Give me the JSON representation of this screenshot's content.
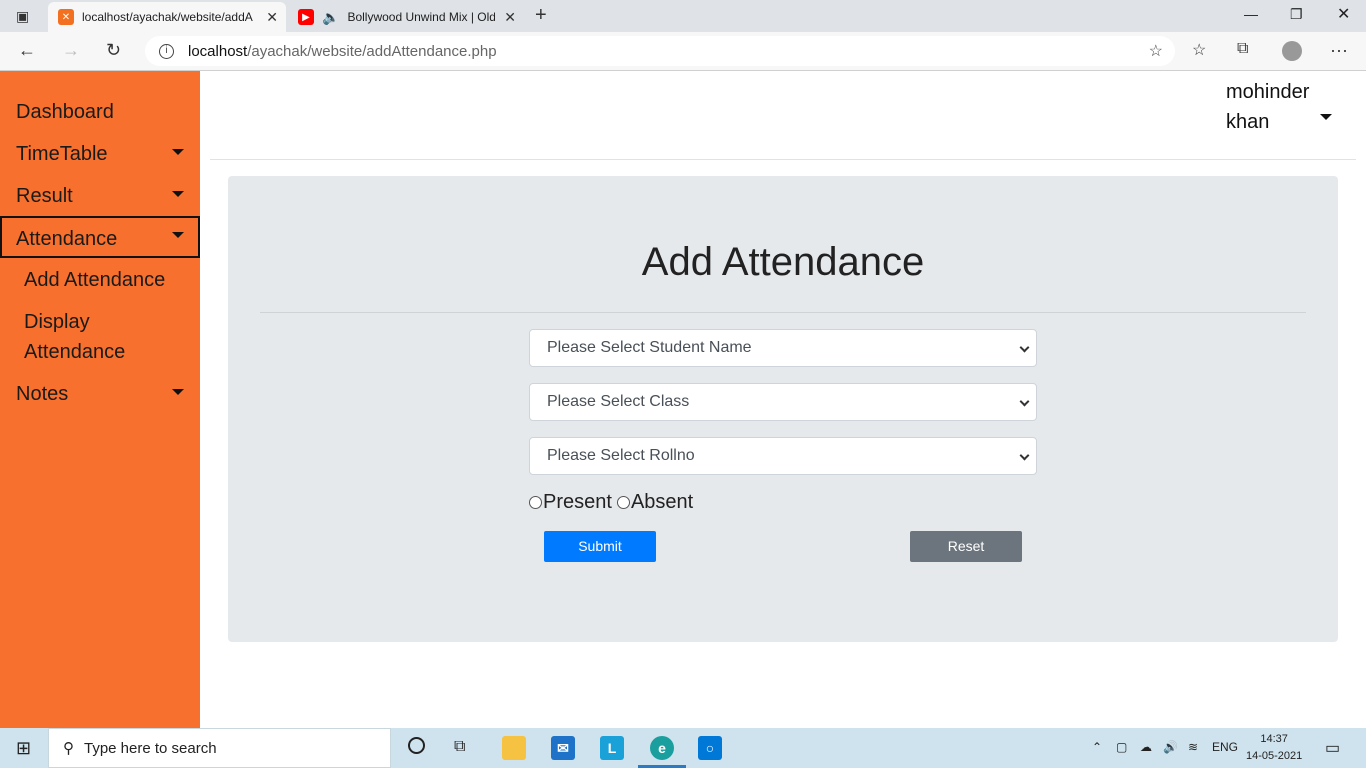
{
  "browser": {
    "tabs": [
      {
        "title": "localhost/ayachak/website/addA",
        "active": true
      },
      {
        "title": "Bollywood Unwind Mix | Old",
        "active": false
      }
    ],
    "url_host": "localhost",
    "url_path": "/ayachak/website/addAttendance.php"
  },
  "sidebar": {
    "items": [
      {
        "label": "Dashboard",
        "has_dropdown": false
      },
      {
        "label": "TimeTable",
        "has_dropdown": true
      },
      {
        "label": "Result",
        "has_dropdown": true
      },
      {
        "label": "Attendance",
        "has_dropdown": true,
        "active": true
      },
      {
        "label": "Notes",
        "has_dropdown": true
      }
    ],
    "sub_items": [
      {
        "label": "Add Attendance"
      },
      {
        "label": "Display Attendance"
      }
    ]
  },
  "user": {
    "first": "mohinder",
    "last": "khan"
  },
  "form": {
    "title": "Add Attendance",
    "student_select": "Please Select Student Name",
    "class_select": "Please Select Class",
    "rollno_select": "Please Select Rollno",
    "present_label": "Present",
    "absent_label": "Absent",
    "submit_label": "Submit",
    "reset_label": "Reset"
  },
  "taskbar": {
    "search_placeholder": "Type here to search",
    "language": "ENG",
    "time": "14:37",
    "date": "14-05-2021"
  },
  "colors": {
    "sidebar": "#f8702d",
    "card": "#e6e9ec",
    "primary": "#007bff",
    "secondary": "#6c757d"
  }
}
